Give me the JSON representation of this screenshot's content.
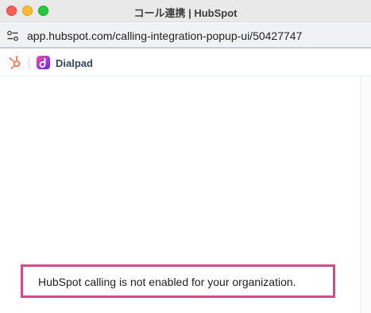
{
  "window": {
    "title": "コール連携 | HubSpot"
  },
  "addressbar": {
    "url": "app.hubspot.com/calling-integration-popup-ui/50427747",
    "icon": "site-settings-icon"
  },
  "appbar": {
    "hubspot_icon": "hubspot-sprocket-icon",
    "provider_name": "Dialpad",
    "provider_icon": "dialpad-logo-icon"
  },
  "content": {
    "message": "HubSpot calling is not enabled for your organization."
  },
  "colors": {
    "hubspot_orange": "#ff7a59",
    "highlight_border": "#cf4c8a",
    "dialpad_gradient_start": "#f24f96",
    "dialpad_gradient_end": "#6a2bd9"
  }
}
